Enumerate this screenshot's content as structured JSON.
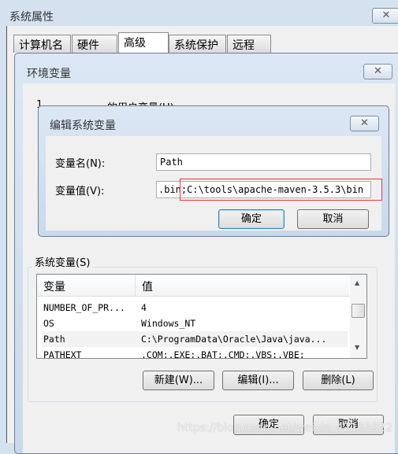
{
  "system_properties": {
    "title": "系统属性",
    "close": "✕",
    "tabs": [
      {
        "label": "计算机名"
      },
      {
        "label": "硬件"
      },
      {
        "label": "高级"
      },
      {
        "label": "系统保护"
      },
      {
        "label": "远程"
      }
    ]
  },
  "env_vars": {
    "title": "环境变量",
    "close": "✕",
    "user_vars_partial": "的用户变量(U)",
    "user_vars_prefix": "1",
    "system_vars_label": "系统变量(S)",
    "columns": [
      "变量",
      "值"
    ],
    "rows": [
      {
        "name": "NUMBER_OF_PR...",
        "value": "4"
      },
      {
        "name": "OS",
        "value": "Windows_NT"
      },
      {
        "name": "Path",
        "value": "C:\\ProgramData\\Oracle\\Java\\java..."
      },
      {
        "name": "PATHEXT",
        "value": ".COM;.EXE;.BAT;.CMD;.VBS;.VBE;"
      }
    ],
    "new_btn": "新建(W)...",
    "edit_btn": "编辑(I)...",
    "delete_btn": "删除(L)",
    "ok": "确定",
    "cancel": "取消"
  },
  "edit_dialog": {
    "title": "编辑系统变量",
    "close": "✕",
    "name_label": "变量名(N):",
    "name_value": "Path",
    "value_label": "变量值(V):",
    "value_prefix": ".bin;",
    "value_value": "C:\\tools\\apache-maven-3.5.3\\bin",
    "ok": "确定",
    "cancel": "取消",
    "highlight_color": "#e53935"
  },
  "watermark": "https://blog.csdn.net/weixin_42131922"
}
